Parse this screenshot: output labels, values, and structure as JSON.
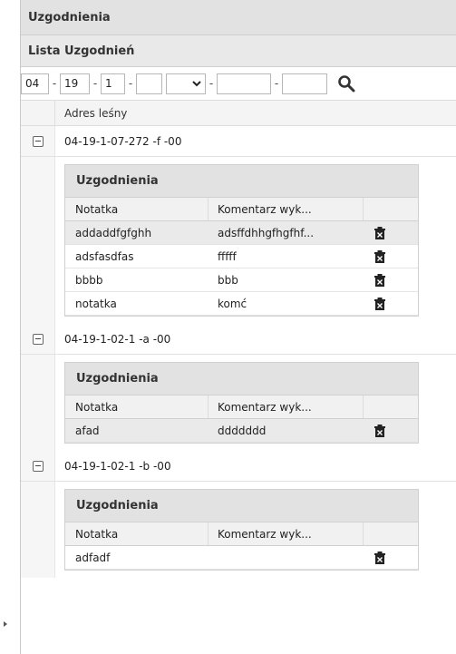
{
  "header": {
    "title": "Uzgodnienia"
  },
  "list": {
    "title": "Lista Uzgodnień"
  },
  "filter": {
    "f1": "04",
    "f2": "19",
    "f3": "1",
    "f4": "",
    "f5": "",
    "f6": "",
    "f7": "",
    "sep": "-"
  },
  "table": {
    "column": "Adres leśny"
  },
  "groups": [
    {
      "address": "04-19-1-07-272 -f -00",
      "title": "Uzgodnienia",
      "col_note": "Notatka",
      "col_comment": "Komentarz wyk...",
      "rows": [
        {
          "note": "addaddfgfghh",
          "comment": "adsffdhhgfhgfhf..."
        },
        {
          "note": "adsfasdfas",
          "comment": "fffff"
        },
        {
          "note": "bbbb",
          "comment": "bbb"
        },
        {
          "note": "notatka",
          "comment": "komć"
        }
      ]
    },
    {
      "address": "04-19-1-02-1 -a -00",
      "title": "Uzgodnienia",
      "col_note": "Notatka",
      "col_comment": "Komentarz wyk...",
      "rows": [
        {
          "note": "afad",
          "comment": "ddddddd"
        }
      ]
    },
    {
      "address": "04-19-1-02-1 -b -00",
      "title": "Uzgodnienia",
      "col_note": "Notatka",
      "col_comment": "Komentarz wyk...",
      "rows": [
        {
          "note": "adfadf",
          "comment": ""
        }
      ]
    }
  ]
}
